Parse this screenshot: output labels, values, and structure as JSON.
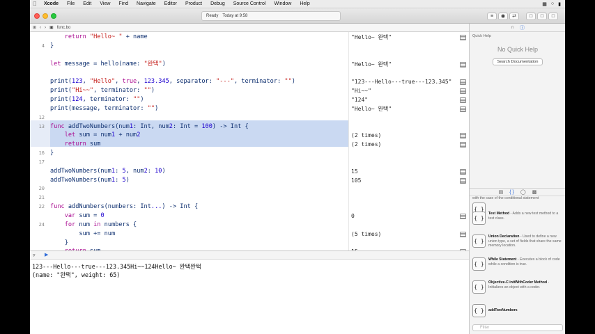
{
  "menubar": {
    "items": [
      "Xcode",
      "File",
      "Edit",
      "View",
      "Find",
      "Navigate",
      "Editor",
      "Product",
      "Debug",
      "Source Control",
      "Window",
      "Help"
    ]
  },
  "toolbar": {
    "status_ready": "Ready",
    "status_time": "Today at 9:58"
  },
  "jumpbar": {
    "file": "func.bo"
  },
  "editor": {
    "lines": [
      {
        "num": "",
        "code": "    return \"Hello~ \" + name",
        "result": "\"Hello~ 완택\""
      },
      {
        "num": "4",
        "code": "}",
        "result": ""
      },
      {
        "num": "",
        "code": "",
        "result": ""
      },
      {
        "num": "",
        "code": "let message = hello(name: \"완택\")",
        "result": "\"Hello~ 완택\""
      },
      {
        "num": "",
        "code": "",
        "result": ""
      },
      {
        "num": "",
        "code": "print(123, \"Hello\", true, 123.345, separator: \"---\", terminator: \"\")",
        "result": "\"123---Hello---true---123.345\""
      },
      {
        "num": "",
        "code": "print(\"Hi~~\", terminator: \"\")",
        "result": "\"Hi~~\""
      },
      {
        "num": "",
        "code": "print(124, terminator: \"\")",
        "result": "\"124\""
      },
      {
        "num": "",
        "code": "print(message, terminator: \"\")",
        "result": "\"Hello~ 완택\""
      },
      {
        "num": "12",
        "code": "",
        "result": ""
      },
      {
        "num": "13",
        "code": "func addTwoNumbers(num1: Int, num2: Int = 100) -> Int {",
        "result": ""
      },
      {
        "num": "",
        "code": "    let sum = num1 + num2",
        "result": "(2 times)"
      },
      {
        "num": "",
        "code": "    return sum",
        "result": "(2 times)"
      },
      {
        "num": "16",
        "code": "}",
        "result": ""
      },
      {
        "num": "17",
        "code": "",
        "result": ""
      },
      {
        "num": "",
        "code": "addTwoNumbers(num1: 5, num2: 10)",
        "result": "15"
      },
      {
        "num": "",
        "code": "addTwoNumbers(num1: 5)",
        "result": "105"
      },
      {
        "num": "20",
        "code": "",
        "result": ""
      },
      {
        "num": "21",
        "code": "",
        "result": ""
      },
      {
        "num": "22",
        "code": "func addNumbers(numbers: Int...) -> Int {",
        "result": ""
      },
      {
        "num": "",
        "code": "    var sum = 0",
        "result": "0"
      },
      {
        "num": "24",
        "code": "    for num in numbers {",
        "result": ""
      },
      {
        "num": "",
        "code": "        sum += num",
        "result": "(5 times)"
      },
      {
        "num": "",
        "code": "    }",
        "result": ""
      },
      {
        "num": "",
        "code": "    return sum",
        "result": "15"
      }
    ]
  },
  "console": {
    "lines": [
      "123---Hello---true---123.345Hi~~124Hello~ 완택완택",
      "(name: \"완택\", weight: 65)"
    ]
  },
  "inspector": {
    "quick_help_title": "Quick Help",
    "no_quick_help": "No Quick Help",
    "search_button": "Search Documentation"
  },
  "library": {
    "items": [
      {
        "icon": "{ }",
        "title": "",
        "desc": "with the case of the conditional statement"
      },
      {
        "icon": "{ }",
        "title": "Test Method",
        "desc": " - Adds a new test method to a test class."
      },
      {
        "icon": "{ }",
        "title": "Union Declaration",
        "desc": " - Used to define a new union type, a set of fields that share the same memory location."
      },
      {
        "icon": "{ }",
        "title": "While Statement",
        "desc": " - Executes a block of code while a condition is true."
      },
      {
        "icon": "{ }",
        "title": "Objective-C initWithCoder Method",
        "desc": " - Initializes an object with a coder."
      },
      {
        "icon": "{ }",
        "title": "addTwoNumbers",
        "desc": ""
      }
    ],
    "filter_placeholder": "Filter"
  }
}
